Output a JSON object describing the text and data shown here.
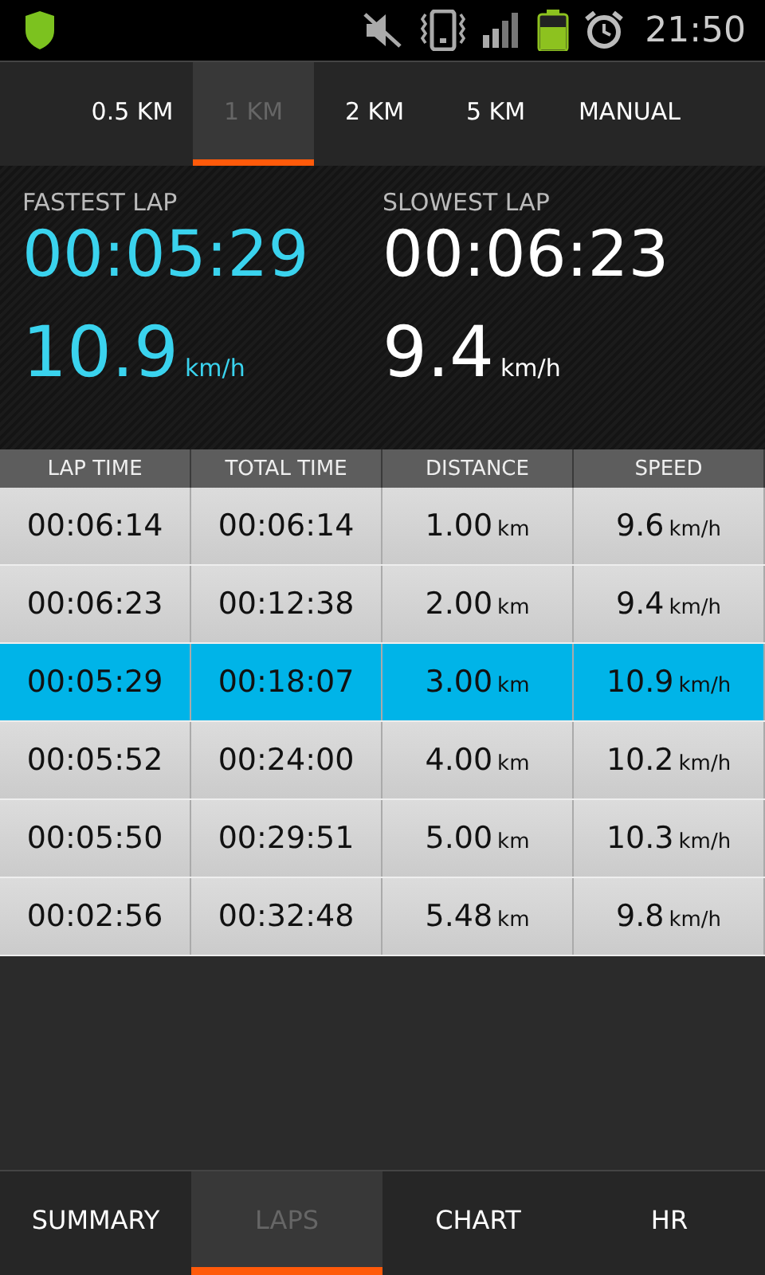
{
  "status_bar": {
    "time": "21:50"
  },
  "distance_tabs": [
    {
      "label": "0.5 KM",
      "selected": false
    },
    {
      "label": "1 KM",
      "selected": true
    },
    {
      "label": "2 KM",
      "selected": false
    },
    {
      "label": "5 KM",
      "selected": false
    },
    {
      "label": "MANUAL",
      "selected": false
    }
  ],
  "stats": [
    {
      "label": "FASTEST LAP",
      "time": "00:05:29",
      "speed": "10.9",
      "unit": "km/h",
      "highlight": true
    },
    {
      "label": "SLOWEST LAP",
      "time": "00:06:23",
      "speed": "9.4",
      "unit": "km/h",
      "highlight": false
    }
  ],
  "table": {
    "columns": [
      "LAP TIME",
      "TOTAL TIME",
      "DISTANCE",
      "SPEED"
    ],
    "rows": [
      {
        "lap_time": "00:06:14",
        "total_time": "00:06:14",
        "distance": "1.00",
        "distance_unit": "km",
        "speed": "9.6",
        "speed_unit": "km/h",
        "selected": false
      },
      {
        "lap_time": "00:06:23",
        "total_time": "00:12:38",
        "distance": "2.00",
        "distance_unit": "km",
        "speed": "9.4",
        "speed_unit": "km/h",
        "selected": false
      },
      {
        "lap_time": "00:05:29",
        "total_time": "00:18:07",
        "distance": "3.00",
        "distance_unit": "km",
        "speed": "10.9",
        "speed_unit": "km/h",
        "selected": true
      },
      {
        "lap_time": "00:05:52",
        "total_time": "00:24:00",
        "distance": "4.00",
        "distance_unit": "km",
        "speed": "10.2",
        "speed_unit": "km/h",
        "selected": false
      },
      {
        "lap_time": "00:05:50",
        "total_time": "00:29:51",
        "distance": "5.00",
        "distance_unit": "km",
        "speed": "10.3",
        "speed_unit": "km/h",
        "selected": false
      },
      {
        "lap_time": "00:02:56",
        "total_time": "00:32:48",
        "distance": "5.48",
        "distance_unit": "km",
        "speed": "9.8",
        "speed_unit": "km/h",
        "selected": false
      }
    ]
  },
  "bottom_tabs": [
    {
      "label": "SUMMARY",
      "selected": false
    },
    {
      "label": "LAPS",
      "selected": true
    },
    {
      "label": "CHART",
      "selected": false
    },
    {
      "label": "HR",
      "selected": false
    }
  ]
}
